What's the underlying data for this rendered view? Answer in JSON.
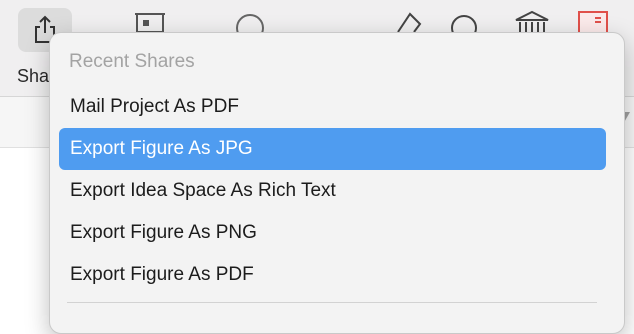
{
  "toolbar": {
    "share_label": "Sha",
    "icons": [
      "share-icon",
      "presentation-icon",
      "circle-icon",
      "highlighter-icon",
      "search-icon",
      "library-icon",
      "inspector-icon"
    ]
  },
  "menu": {
    "header": "Recent Shares",
    "items": [
      {
        "label": "Mail Project As PDF",
        "selected": false
      },
      {
        "label": "Export Figure As JPG",
        "selected": true
      },
      {
        "label": "Export Idea Space As Rich Text",
        "selected": false
      },
      {
        "label": "Export Figure As PNG",
        "selected": false
      },
      {
        "label": "Export Figure As PDF",
        "selected": false
      }
    ]
  },
  "colors": {
    "selection": "#4f9cf0",
    "menu_bg": "#f3f3f3",
    "header_text": "#a3a3a3",
    "accent_red": "#e0504a"
  }
}
